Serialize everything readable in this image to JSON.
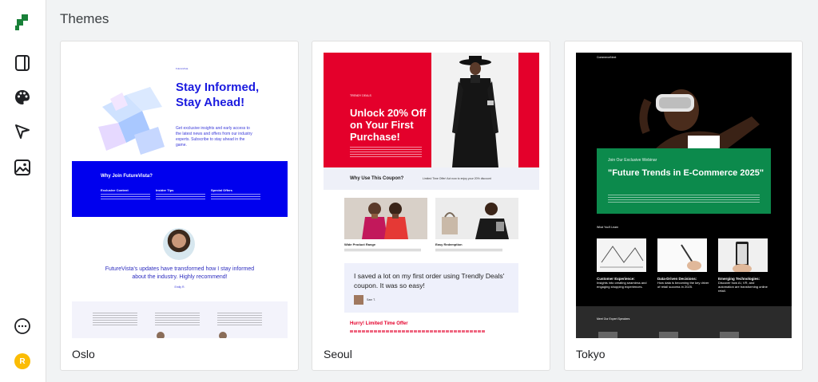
{
  "app": {
    "brand_color": "#188038",
    "accent_color": "#1a1adf"
  },
  "sidebar": {
    "items": [
      {
        "name": "templates",
        "icon": "templates-icon"
      },
      {
        "name": "themes",
        "icon": "palette-icon"
      },
      {
        "name": "send",
        "icon": "send-icon"
      },
      {
        "name": "media",
        "icon": "image-icon"
      },
      {
        "name": "more",
        "icon": "more-horizontal-icon"
      }
    ],
    "avatar_initial": "R"
  },
  "page": {
    "title": "Themes"
  },
  "themes": [
    {
      "name": "Oslo",
      "preview": {
        "brand": "FutureVista",
        "headline": "Stay Informed, Stay Ahead!",
        "subtext": "Get exclusive insights and early access to the latest news and offers from our industry experts. Subscribe to stay ahead in the game.",
        "band_title": "Why Join FutureVista?",
        "features": [
          "Exclusive Content",
          "Insider Tips",
          "Special Offers"
        ],
        "quote": "FutureVista's updates have transformed how I stay informed about the industry. Highly recommend!",
        "author": "Emily R."
      }
    },
    {
      "name": "Seoul",
      "preview": {
        "tag": "TRENDY DEALS",
        "headline": "Unlock 20% Off on Your First Purchase!",
        "band_title": "Why Use This Coupon?",
        "band_text": "Limited Time Offer! Act now to enjoy your 20% discount",
        "products": [
          "Wide Product Range",
          "Easy Redemption"
        ],
        "quote": "I saved a lot on my first order using Trendly Deals' coupon. It was so easy!",
        "quote_author": "Sam T.",
        "hurry": "Hurry! Limited Time Offer"
      }
    },
    {
      "name": "Tokyo",
      "preview": {
        "brand": "CommerceNext",
        "kicker": "Join Our Exclusive Webinar",
        "headline": "\"Future Trends in E-Commerce 2025\"",
        "section": "What You'll Learn",
        "topics": [
          {
            "title": "Customer Experience:",
            "text": "Insights into creating seamless and engaging shopping experiences."
          },
          {
            "title": "Data-Driven Decisions:",
            "text": "How data is becoming the key driver of retail success in 2025."
          },
          {
            "title": "Emerging Technologies:",
            "text": "Discover how AI, VR, and automation are transforming online retail."
          }
        ],
        "speakers": "Meet Our Expert Speakers"
      }
    }
  ]
}
